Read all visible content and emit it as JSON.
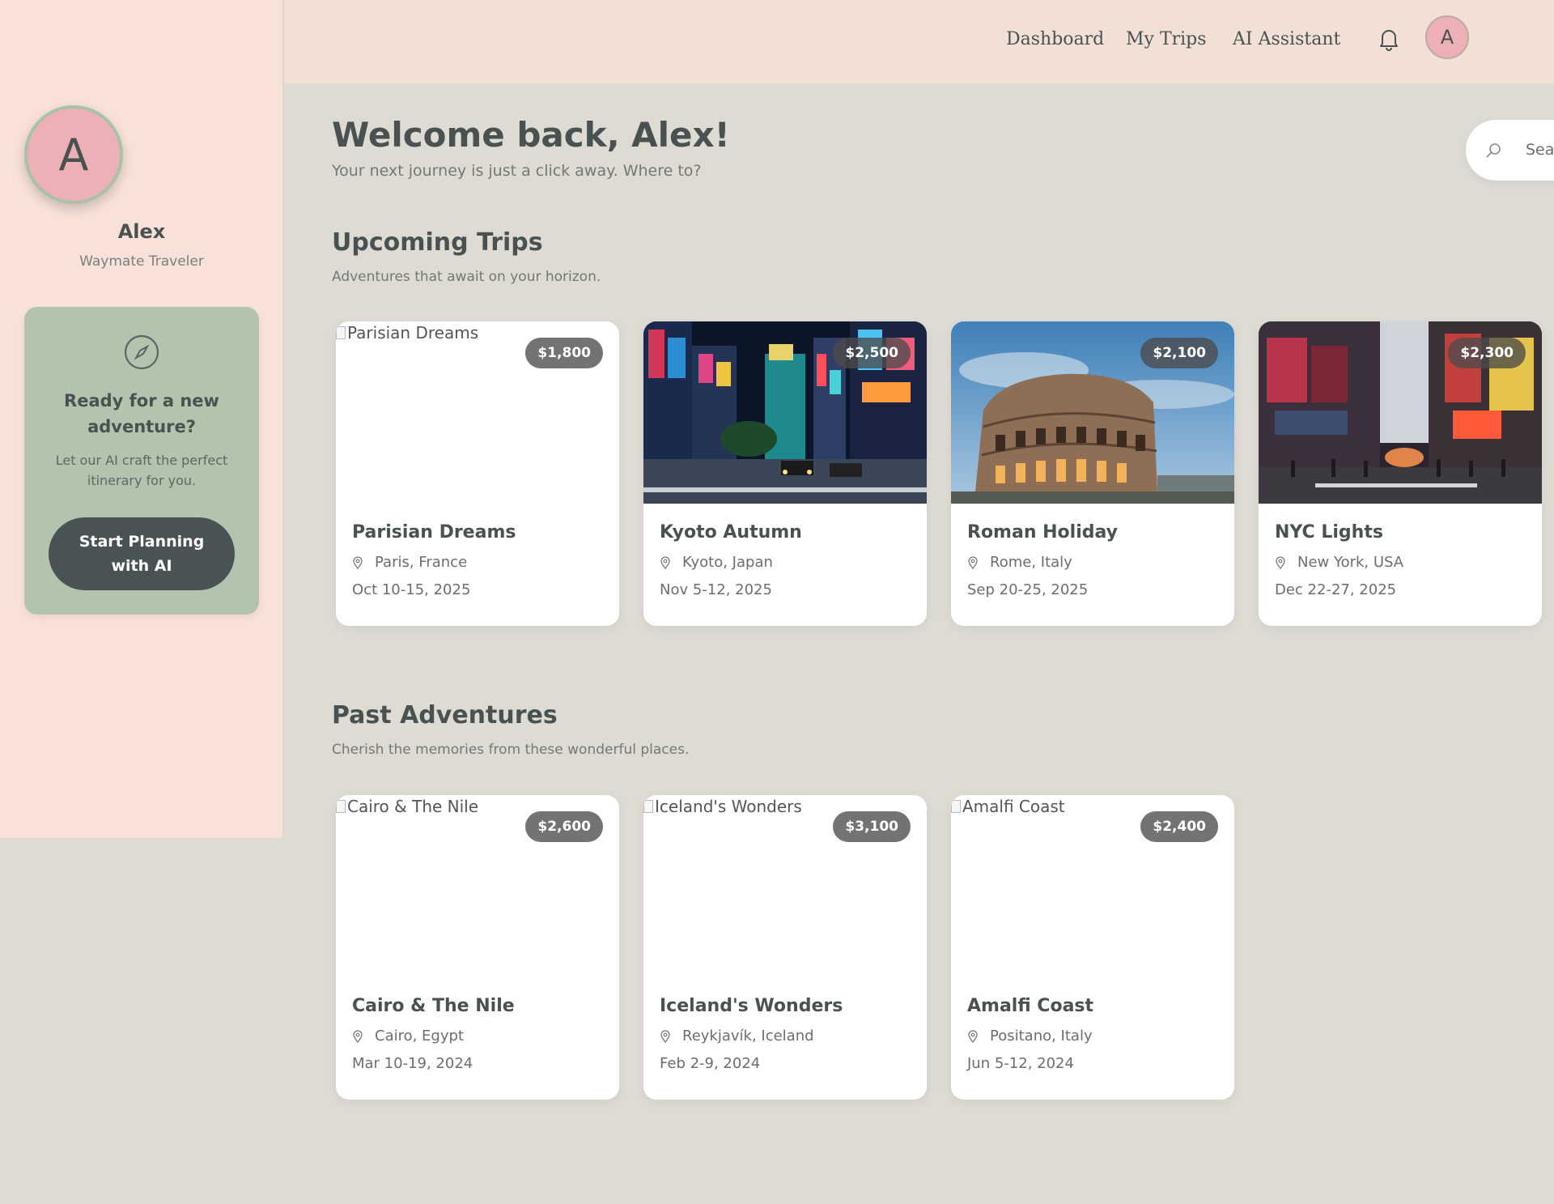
{
  "sidebar": {
    "avatar_initial": "A",
    "user_name": "Alex",
    "user_role": "Waymate Traveler",
    "promo": {
      "icon": "compass-icon",
      "title": "Ready for a new adventure?",
      "text": "Let our AI craft the perfect itinerary for you.",
      "button_label": "Start Planning with AI"
    }
  },
  "topbar": {
    "nav": [
      "Dashboard",
      "My Trips",
      "AI Assistant"
    ],
    "bell_icon": "bell-icon",
    "avatar_initial": "A"
  },
  "main": {
    "welcome_title": "Welcome back, Alex!",
    "welcome_subtitle": "Your next journey is just a click away. Where to?",
    "search": {
      "placeholder": "Search",
      "icon": "search-icon"
    },
    "upcoming": {
      "title": "Upcoming Trips",
      "subtitle": "Adventures that await on your horizon.",
      "trips": [
        {
          "title": "Parisian Dreams",
          "location": "Paris, France",
          "dates": "Oct 10-15, 2025",
          "price": "$1,800",
          "image_alt": "Parisian Dreams",
          "image_loaded": false
        },
        {
          "title": "Kyoto Autumn",
          "location": "Kyoto, Japan",
          "dates": "Nov 5-12, 2025",
          "price": "$2,500",
          "image_alt": "Kyoto Autumn",
          "image_loaded": true
        },
        {
          "title": "Roman Holiday",
          "location": "Rome, Italy",
          "dates": "Sep 20-25, 2025",
          "price": "$2,100",
          "image_alt": "Roman Holiday",
          "image_loaded": true
        },
        {
          "title": "NYC Lights",
          "location": "New York, USA",
          "dates": "Dec 22-27, 2025",
          "price": "$2,300",
          "image_alt": "NYC Lights",
          "image_loaded": true
        }
      ]
    },
    "past": {
      "title": "Past Adventures",
      "subtitle": "Cherish the memories from these wonderful places.",
      "trips": [
        {
          "title": "Cairo & The Nile",
          "location": "Cairo, Egypt",
          "dates": "Mar 10-19, 2024",
          "price": "$2,600",
          "image_alt": "Cairo & The Nile",
          "image_loaded": false
        },
        {
          "title": "Iceland's Wonders",
          "location": "Reykjavík, Iceland",
          "dates": "Feb 2-9, 2024",
          "price": "$3,100",
          "image_alt": "Iceland's Wonders",
          "image_loaded": false
        },
        {
          "title": "Amalfi Coast",
          "location": "Positano, Italy",
          "dates": "Jun 5-12, 2024",
          "price": "$2,400",
          "image_alt": "Amalfi Coast",
          "image_loaded": false
        }
      ]
    }
  },
  "colors": {
    "sidebar_bg": "#f7e1d8",
    "main_bg": "#dedbd3",
    "promo_bg": "#b2c4ad",
    "button_bg": "#495353",
    "avatar_bg": "#eeb0b7",
    "text_dark": "#4a5151"
  }
}
